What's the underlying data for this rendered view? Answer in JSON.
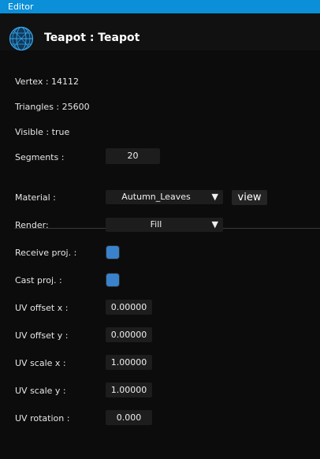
{
  "window": {
    "title": "Editor"
  },
  "header": {
    "title": "Teapot : Teapot",
    "icon": "sphere-icon"
  },
  "stats": {
    "vertex": "Vertex : 14112",
    "triangles": "Triangles : 25600",
    "visible": "Visible : true"
  },
  "segments": {
    "label": "Segments :",
    "value": "20"
  },
  "material": {
    "label": "Material :",
    "value": "Autumn_Leaves",
    "view_label": "view"
  },
  "render": {
    "label": "Render:",
    "value": "Fill"
  },
  "receive_proj": {
    "label": "Receive proj. :",
    "checked": true
  },
  "cast_proj": {
    "label": "Cast proj. :",
    "checked": true
  },
  "uv_offset_x": {
    "label": "UV offset x :",
    "value": "0.00000"
  },
  "uv_offset_y": {
    "label": "UV offset y :",
    "value": "0.00000"
  },
  "uv_scale_x": {
    "label": "UV scale x :",
    "value": "1.00000"
  },
  "uv_scale_y": {
    "label": "UV scale y :",
    "value": "1.00000"
  },
  "uv_rotation": {
    "label": "UV rotation :",
    "value": "0.000"
  },
  "colors": {
    "titlebar": "#0a8fd8",
    "accent": "#3a82cc",
    "background": "#0c0c0c",
    "field": "#1d1d1d"
  }
}
